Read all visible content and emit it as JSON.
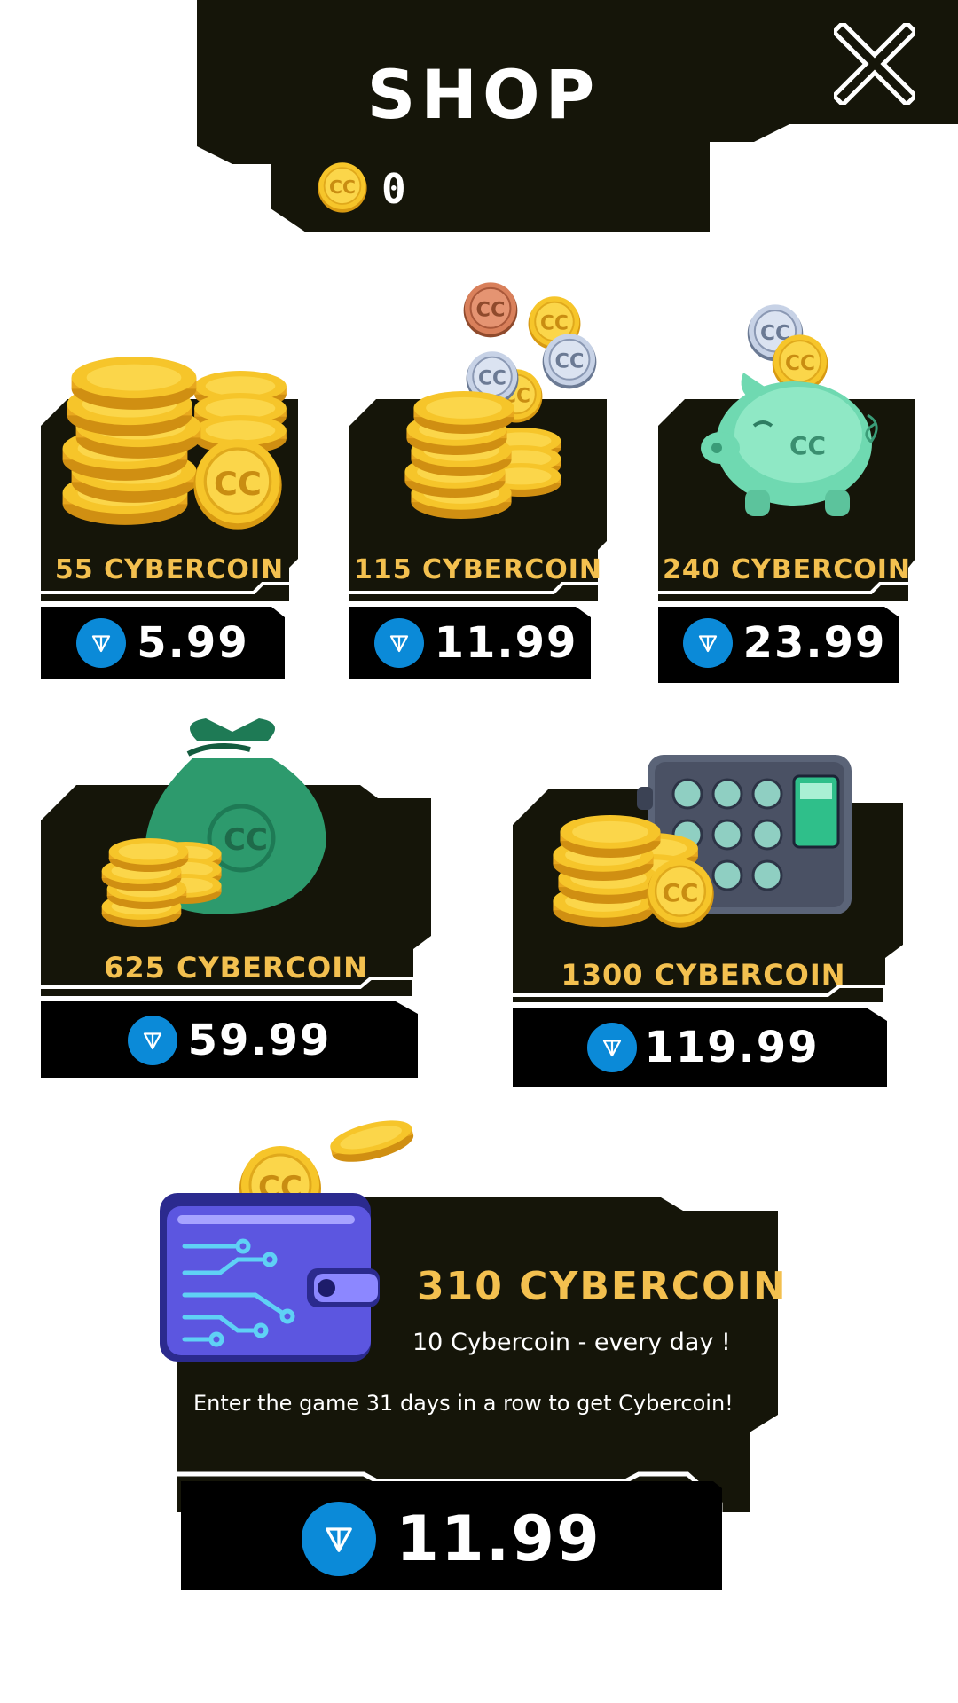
{
  "header": {
    "title": "SHOP",
    "currency_icon": "cc-coin-icon",
    "close_icon": "close-icon"
  },
  "balance": {
    "value": "0"
  },
  "price_icon": "ton-diamond-icon",
  "packs": [
    {
      "amount_label": "55 CYBERCOIN",
      "price": "5.99",
      "image": "coin-stack-icon"
    },
    {
      "amount_label": "115 CYBERCOIN",
      "price": "11.99",
      "image": "coin-stack-falling-icon"
    },
    {
      "amount_label": "240 CYBERCOIN",
      "price": "23.99",
      "image": "piggy-bank-icon"
    },
    {
      "amount_label": "625 CYBERCOIN",
      "price": "59.99",
      "image": "money-bag-icon"
    },
    {
      "amount_label": "1300 CYBERCOIN",
      "price": "119.99",
      "image": "safe-icon"
    }
  ],
  "subscription": {
    "title": "310 CYBERCOIN",
    "daily": "10 Cybercoin - every day !",
    "description": "Enter the game 31 days in a row to get Cybercoin!",
    "price": "11.99",
    "image": "wallet-icon"
  },
  "colors": {
    "panel": "#151509",
    "price_bg": "#000000",
    "label": "#f3c04f",
    "ton": "#0b8ad8",
    "coin": "#f6c52a"
  }
}
